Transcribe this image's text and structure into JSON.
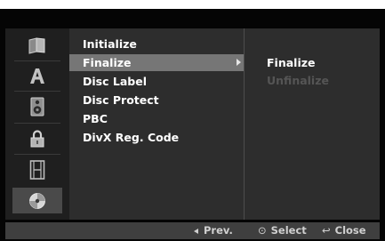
{
  "menu": {
    "icons": [
      {
        "name": "book-icon",
        "selected": false
      },
      {
        "name": "font-a-icon",
        "selected": false
      },
      {
        "name": "speaker-icon",
        "selected": false
      },
      {
        "name": "lock-icon",
        "selected": false
      },
      {
        "name": "film-icon",
        "selected": false
      },
      {
        "name": "disc-icon",
        "selected": true
      }
    ],
    "items": [
      {
        "label": "Initialize"
      },
      {
        "label": "Finalize",
        "highlighted": true,
        "has_submenu": true
      },
      {
        "label": "Disc Label"
      },
      {
        "label": "Disc Protect"
      },
      {
        "label": "PBC"
      },
      {
        "label": "DivX Reg. Code"
      }
    ],
    "submenu": [
      {
        "label": "Finalize",
        "enabled": true
      },
      {
        "label": "Unfinalize",
        "enabled": false
      }
    ]
  },
  "footer": {
    "prev_label": "Prev.",
    "select_label": "Select",
    "close_label": "Close"
  },
  "colors": {
    "highlight": "#767676",
    "text": "#ffffff",
    "disabled_text": "#555555",
    "panel": "#2d2d2d",
    "icon_panel": "#1f1f1f",
    "footer_bar": "#3f3f3f"
  }
}
